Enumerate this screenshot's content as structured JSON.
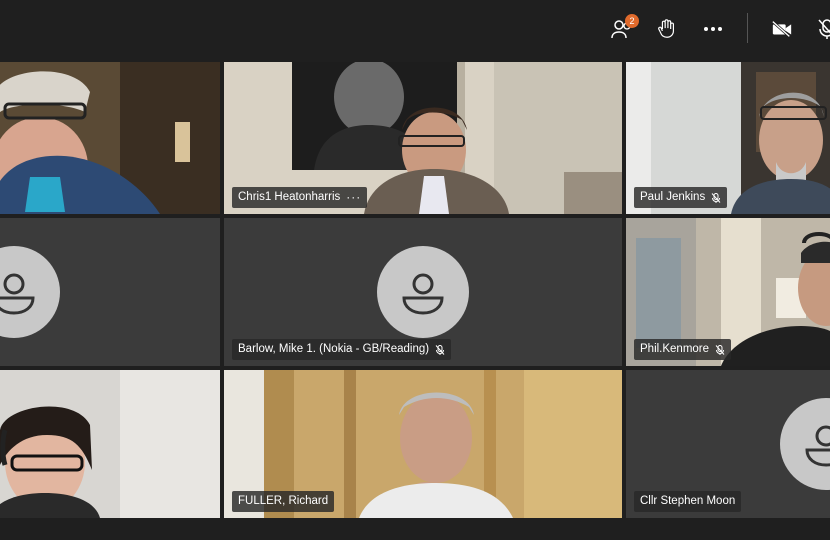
{
  "toolbar": {
    "participants_badge": "2",
    "icons": [
      "participants-icon",
      "raise-hand-icon",
      "more-options-icon",
      "camera-off-icon",
      "mic-off-icon"
    ]
  },
  "tiles": [
    {
      "name": "",
      "muted": false
    },
    {
      "name": "Chris1 Heatonharris",
      "muted": false,
      "more": "···"
    },
    {
      "name": "Paul Jenkins",
      "muted": true
    },
    {
      "name": "",
      "muted": false
    },
    {
      "name": "Barlow, Mike 1. (Nokia - GB/Reading)",
      "muted": true
    },
    {
      "name": "Phil.Kenmore",
      "muted": true
    },
    {
      "name": "",
      "muted": false
    },
    {
      "name": "FULLER, Richard",
      "muted": false
    },
    {
      "name": "Cllr Stephen Moon",
      "muted": false
    }
  ],
  "colors": {
    "background": "#1f1f1f",
    "tile_empty": "#3b3b3b",
    "avatar": "#c8c8c8",
    "badge": "#e06a2c"
  }
}
